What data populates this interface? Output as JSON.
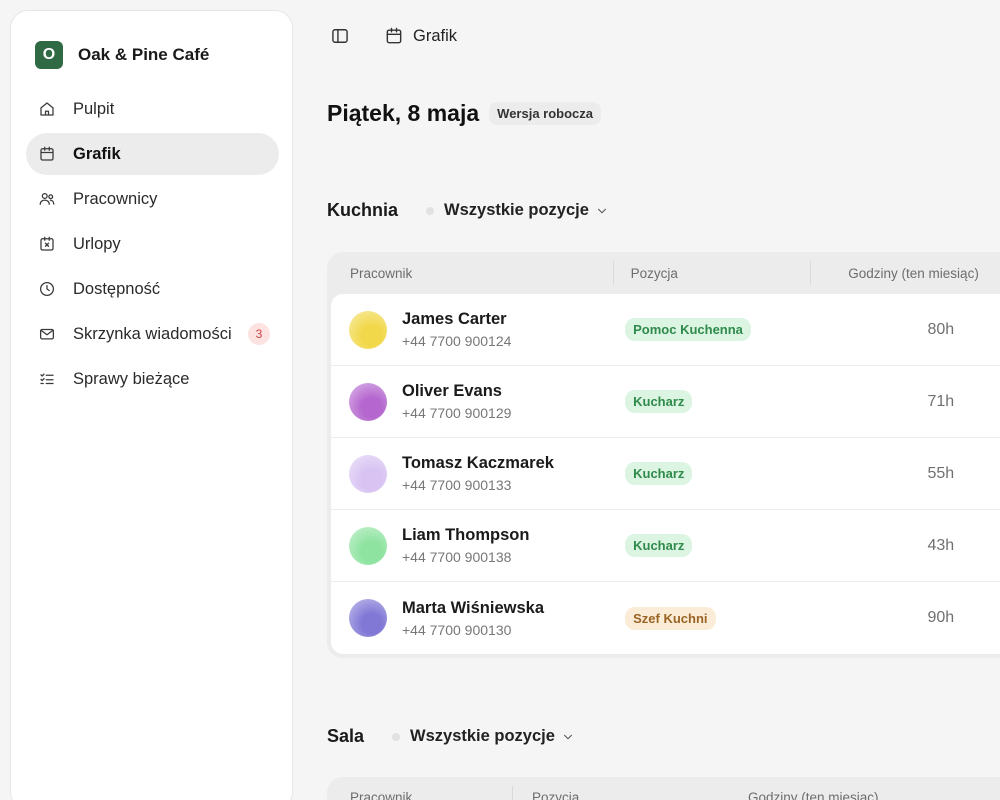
{
  "app": {
    "name": "Oak & Pine Café",
    "logo_letter": "O"
  },
  "sidebar": {
    "items": [
      {
        "label": "Pulpit",
        "icon": "home-icon",
        "active": false
      },
      {
        "label": "Grafik",
        "icon": "calendar-icon",
        "active": true
      },
      {
        "label": "Pracownicy",
        "icon": "users-icon",
        "active": false
      },
      {
        "label": "Urlopy",
        "icon": "calendar-x-icon",
        "active": false
      },
      {
        "label": "Dostępność",
        "icon": "clock-icon",
        "active": false
      },
      {
        "label": "Skrzynka wiadomości",
        "icon": "mail-icon",
        "active": false,
        "badge": "3"
      },
      {
        "label": "Sprawy bieżące",
        "icon": "checklist-icon",
        "active": false
      }
    ]
  },
  "topbar": {
    "breadcrumb": "Grafik"
  },
  "day": {
    "title": "Piątek, 8 maja",
    "badge": "Wersja robocza"
  },
  "sections": [
    {
      "title": "Kuchnia",
      "filter": "Wszystkie pozycje",
      "columns": [
        "Pracownik",
        "Pozycja",
        "Godziny (ten miesiąc)"
      ],
      "rows": [
        {
          "name": "James Carter",
          "phone": "+44 7700 900124",
          "position": "Pomoc Kuchenna",
          "hours": "80h",
          "avatar_color": "#f1d84a",
          "pill_bg": "#dcf5e3",
          "pill_fg": "#2f8a4c"
        },
        {
          "name": "Oliver Evans",
          "phone": "+44 7700 900129",
          "position": "Kucharz",
          "hours": "71h",
          "avatar_color": "#b567cf",
          "pill_bg": "#dcf5e3",
          "pill_fg": "#2f8a4c"
        },
        {
          "name": "Tomasz Kaczmarek",
          "phone": "+44 7700 900133",
          "position": "Kucharz",
          "hours": "55h",
          "avatar_color": "#d8c3f2",
          "pill_bg": "#dcf5e3",
          "pill_fg": "#2f8a4c"
        },
        {
          "name": "Liam Thompson",
          "phone": "+44 7700 900138",
          "position": "Kucharz",
          "hours": "43h",
          "avatar_color": "#8ee3a0",
          "pill_bg": "#dcf5e3",
          "pill_fg": "#2f8a4c"
        },
        {
          "name": "Marta Wiśniewska",
          "phone": "+44 7700 900130",
          "position": "Szef Kuchni",
          "hours": "90h",
          "avatar_color": "#8178d6",
          "pill_bg": "#fbecd7",
          "pill_fg": "#9a6424"
        }
      ]
    },
    {
      "title": "Sala",
      "filter": "Wszystkie pozycje",
      "columns": [
        "Pracownik",
        "Pozycja",
        "Godziny (ten miesiąc)"
      ]
    }
  ]
}
